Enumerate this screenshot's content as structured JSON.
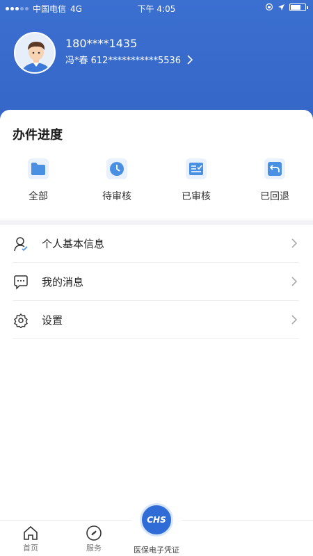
{
  "status_bar": {
    "carrier": "中国电信",
    "network": "4G",
    "time": "下午 4:05",
    "battery_level": 0.7
  },
  "profile": {
    "phone": "180****1435",
    "name_id": "冯*春  612***********5536"
  },
  "progress": {
    "title": "办件进度",
    "items": [
      {
        "label": "全部",
        "icon": "folder-icon"
      },
      {
        "label": "待审核",
        "icon": "clock-icon"
      },
      {
        "label": "已审核",
        "icon": "checklist-icon"
      },
      {
        "label": "已回退",
        "icon": "return-icon"
      }
    ]
  },
  "menu": {
    "items": [
      {
        "label": "个人基本信息",
        "icon": "user-info-icon"
      },
      {
        "label": "我的消息",
        "icon": "message-icon"
      },
      {
        "label": "设置",
        "icon": "gear-icon"
      }
    ]
  },
  "tabbar": {
    "home": "首页",
    "service": "服务",
    "center_badge": "CHS",
    "center": "医保电子凭证"
  },
  "colors": {
    "brand_blue": "#3566c7",
    "accent_blue": "#2f6cd6"
  }
}
